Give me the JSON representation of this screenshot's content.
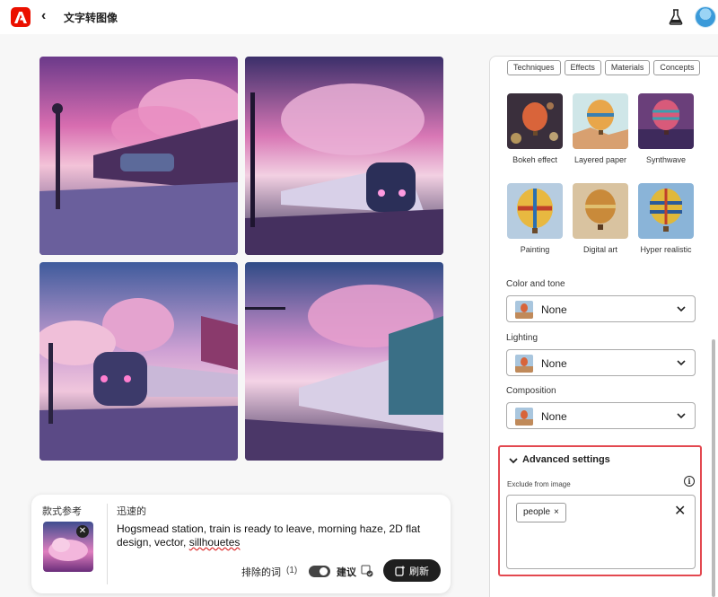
{
  "header": {
    "title": "文字转图像",
    "back_glyph": "‹"
  },
  "prompt": {
    "style_ref_label": "款式参考",
    "mode_label": "迅速的",
    "text_before": "Hogsmead station, train is ready to leave, morning haze, 2D flat design, vector, ",
    "text_underlined": "sillhouetes",
    "thumb_close": "✕",
    "exclude_label": "排除的词",
    "exclude_count": "(1)",
    "suggest_label": "建议",
    "refresh_label": "刷新"
  },
  "panel": {
    "chips": [
      "Techniques",
      "Effects",
      "Materials",
      "Concepts"
    ],
    "styles": [
      "Bokeh effect",
      "Layered paper",
      "Synthwave",
      "Painting",
      "Digital art",
      "Hyper realistic"
    ],
    "color_tone": {
      "label": "Color and tone",
      "value": "None"
    },
    "lighting": {
      "label": "Lighting",
      "value": "None"
    },
    "composition": {
      "label": "Composition",
      "value": "None"
    },
    "advanced": {
      "title": "Advanced settings",
      "exclude_label": "Exclude from image",
      "info_glyph": "i",
      "tag": "people",
      "tag_remove": "×",
      "clear_glyph": "✕"
    }
  },
  "colors": {
    "brand": "#eb1000",
    "highlight_border": "#e34850",
    "button_dark": "#1f1f1f"
  }
}
